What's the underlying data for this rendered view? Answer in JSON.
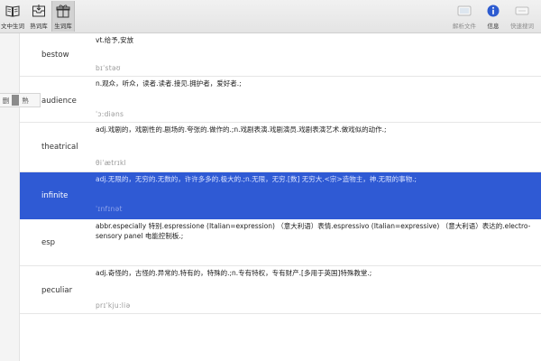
{
  "toolbar": {
    "left": [
      {
        "name": "tool-text-to-words",
        "label": "文中生词",
        "icon": "book-icon",
        "active": false
      },
      {
        "name": "tool-familiar-words",
        "label": "熟词库",
        "icon": "tray-icon",
        "active": false
      },
      {
        "name": "tool-new-words",
        "label": "生词库",
        "icon": "gift-icon",
        "active": true
      }
    ],
    "right": [
      {
        "name": "tool-parse-file",
        "label": "解析文件",
        "icon": "doc-icon",
        "enabled": false
      },
      {
        "name": "tool-info",
        "label": "信息",
        "icon": "info-icon",
        "enabled": true
      },
      {
        "name": "tool-quick-search",
        "label": "快速搜词",
        "icon": "search-box-icon",
        "enabled": false
      }
    ]
  },
  "toggle": {
    "left_label": "删",
    "right_label": "熟"
  },
  "words": [
    {
      "word": "bestow",
      "definition": "vt.给予,安放",
      "pronunciation": "bɪˈstəʊ",
      "selected": false
    },
    {
      "word": "audience",
      "definition": "n.观众，听众，读者.读者.接见.拥护者，爱好者.;",
      "pronunciation": "ˈɔ:diəns",
      "selected": false
    },
    {
      "word": "theatrical",
      "definition": "adj.戏剧的，戏剧性的.剧场的.夸张的.做作的.;n.戏剧表演.戏剧演员.戏剧表演艺术.做戏似的动作.;",
      "pronunciation": "θiˈætrɪkl",
      "selected": false
    },
    {
      "word": "infinite",
      "definition": "adj.无限的，无穷的.无数的，许许多多的.极大的.;n.无限，无穷.[数] 无穷大.<宗>造物主，神.无限的事物.;",
      "pronunciation": "ˈɪnfɪnət",
      "selected": true
    },
    {
      "word": "esp",
      "definition": "abbr.especially 特别.espressione (Italian=expression) （意大利语）表情.espressivo (Italian=expressive) （意大利语）表达的.electro-sensory panel 电能控制板.;",
      "pronunciation": "",
      "selected": false
    },
    {
      "word": "peculiar",
      "definition": "adj.奇怪的，古怪的.异常的.特有的，特殊的.;n.专有特权，专有财产.[多用于英国]特殊教堂.;",
      "pronunciation": "prɪˈkju:liə",
      "selected": false
    }
  ],
  "colors": {
    "selection": "#2f5ad4",
    "toolbar": "#e8e8e8",
    "info_icon": "#2d5bd0"
  }
}
